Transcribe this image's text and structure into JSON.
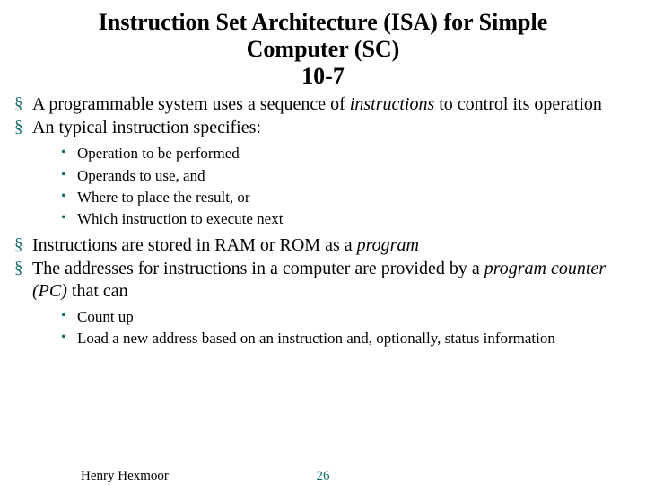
{
  "title": {
    "line1": "Instruction Set Architecture (ISA) for Simple",
    "line2": "Computer (SC)",
    "line3": "10-7"
  },
  "bullets": {
    "b1a": "A programmable system uses a sequence of ",
    "b1i": "instructions",
    "b1b": " to control its operation",
    "b2": "An typical instruction specifies:",
    "sub1": {
      "s1": "Operation to be performed",
      "s2": "Operands to use, and",
      "s3": "Where to place the result, or",
      "s4": "Which instruction to execute next"
    },
    "b3a": "Instructions are stored in RAM or ROM as a ",
    "b3i": "program",
    "b4a": "The addresses for instructions in a computer are provided by a ",
    "b4i": "program counter (PC)",
    "b4b": " that can",
    "sub2": {
      "s1": "Count up",
      "s2": "Load a new address based on an instruction and, optionally, status information"
    }
  },
  "footer": {
    "author": "Henry Hexmoor",
    "page": "26"
  }
}
